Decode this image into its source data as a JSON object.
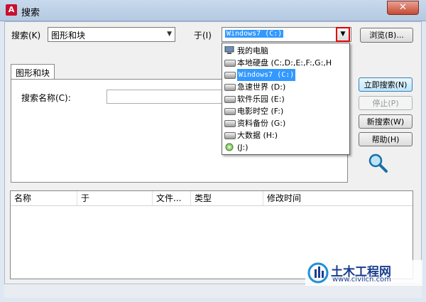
{
  "window": {
    "title": "搜索",
    "close": "✕"
  },
  "search_row": {
    "label": "搜索(K)",
    "type_value": "图形和块",
    "in_label": "于(I)",
    "location_value": "Windows7 (C:)",
    "browse": "浏览(B)..."
  },
  "tab": {
    "label": "图形和块",
    "name_label": "搜索名称(C):"
  },
  "buttons": {
    "search_now": "立即搜索(N)",
    "stop": "停止(P)",
    "new_search": "新搜索(W)",
    "help": "帮助(H)"
  },
  "dropdown_items": [
    {
      "label": "我的电脑",
      "icon": "computer-icon"
    },
    {
      "label": "本地硬盘 (C:,D:,E:,F:,G:,H",
      "icon": "drive-icon"
    },
    {
      "label": "Windows7 (C:)",
      "icon": "drive-icon",
      "selected": true
    },
    {
      "label": "急速世界 (D:)",
      "icon": "drive-icon"
    },
    {
      "label": "软件乐园 (E:)",
      "icon": "drive-icon"
    },
    {
      "label": "电影时空 (F:)",
      "icon": "drive-icon"
    },
    {
      "label": "资料备份 (G:)",
      "icon": "drive-icon"
    },
    {
      "label": "大数据 (H:)",
      "icon": "drive-icon"
    },
    {
      "label": "(J:)",
      "icon": "cd-drive-icon"
    }
  ],
  "results": {
    "columns": [
      "名称",
      "于",
      "文件...",
      "类型",
      "修改时间"
    ]
  },
  "watermark": {
    "brand": "土木工程网",
    "url": "www.civilcn.com"
  },
  "colors": {
    "selection": "#3399ff",
    "highlight_border": "#e00000",
    "accent": "#3c7fb1"
  }
}
